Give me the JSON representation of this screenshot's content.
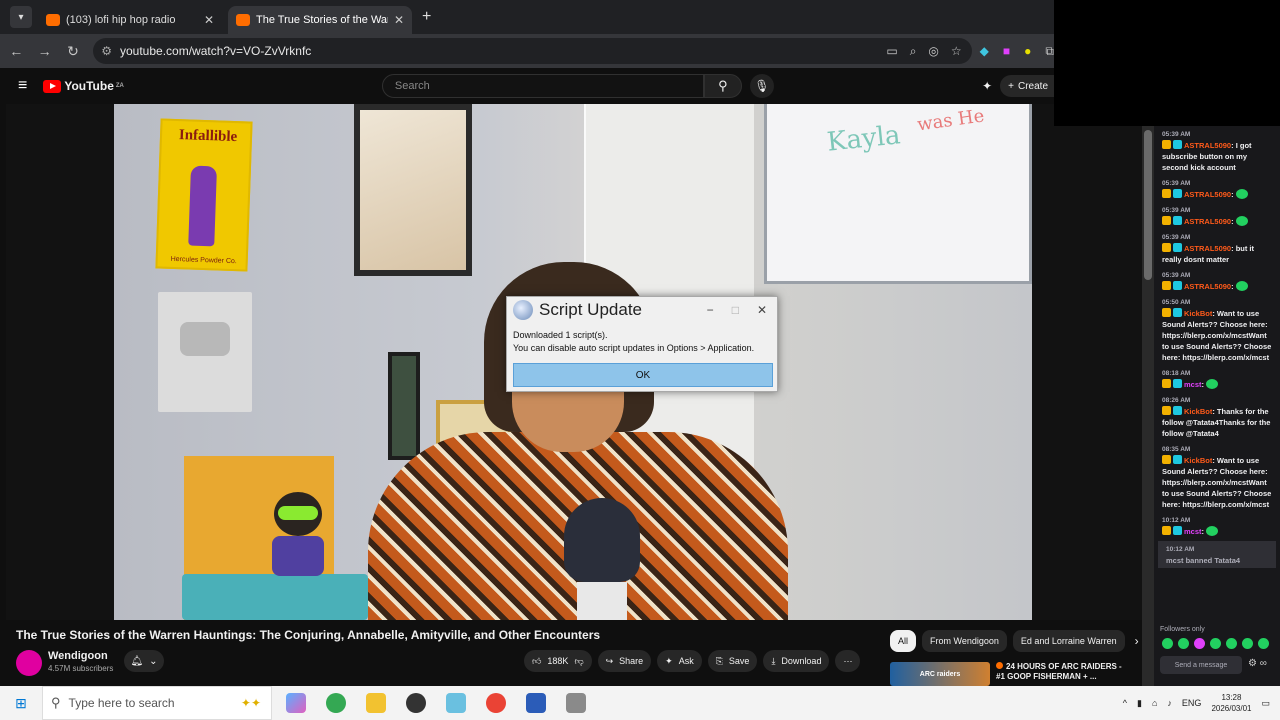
{
  "browser": {
    "tabs": [
      {
        "title": "(103) lofi hip hop radio",
        "active": false
      },
      {
        "title": "The True Stories of the War",
        "active": true
      }
    ],
    "url": "youtube.com/watch?v=VO-ZvVrknfc"
  },
  "youtube": {
    "logo_text": "YouTube",
    "logo_region": "ZA",
    "search_placeholder": "Search",
    "create_label": "Create"
  },
  "video": {
    "poster_title": "Infallible",
    "poster_footer": "Hercules Powder Co.",
    "whiteboard_text_1": "Kayla",
    "whiteboard_text_2": "was He",
    "title": "The True Stories of the Warren Hauntings: The Conjuring, Annabelle, Amityville, and Other Encounters",
    "channel": "Wendigoon",
    "subscribers": "4.57M subscribers",
    "likes": "188K",
    "share_label": "Share",
    "ask_label": "Ask",
    "save_label": "Save",
    "download_label": "Download"
  },
  "chips": [
    "All",
    "From Wendigoon",
    "Ed and Lorraine Warren"
  ],
  "up_next": {
    "thumb_text": "ARC raiders",
    "title": "24 HOURS OF ARC RAIDERS - #1 GOOP FISHERMAN + ..."
  },
  "dialog": {
    "title": "Script Update",
    "line1": "Downloaded 1 script(s).",
    "line2": "You can disable auto script updates in Options > Application.",
    "ok_label": "OK"
  },
  "chat": {
    "messages": [
      {
        "time": "05:39 AM",
        "user": "ASTRAL5090",
        "text": ": I got subscribe button on my second kick account",
        "user_color": "#ff5a1a"
      },
      {
        "time": "05:39 AM",
        "user": "ASTRAL5090",
        "text": ":",
        "user_color": "#ff5a1a",
        "emote": true
      },
      {
        "time": "05:39 AM",
        "user": "ASTRAL5090",
        "text": ":",
        "user_color": "#ff5a1a",
        "emote": true
      },
      {
        "time": "05:39 AM",
        "user": "ASTRAL5090",
        "text": ": but it really dosnt matter",
        "user_color": "#ff5a1a"
      },
      {
        "time": "05:39 AM",
        "user": "ASTRAL5090",
        "text": ":",
        "user_color": "#ff5a1a",
        "emote": true
      },
      {
        "time": "05:50 AM",
        "user": "KickBot",
        "text": ": Want to use Sound Alerts?? Choose here: https://blerp.com/x/mcstWant to use Sound Alerts?? Choose here: https://blerp.com/x/mcst",
        "user_color": "#ff5a1a"
      },
      {
        "time": "08:18 AM",
        "user": "mcst",
        "text": ":",
        "user_color": "#e040fb",
        "emote": true
      },
      {
        "time": "08:26 AM",
        "user": "KickBot",
        "text": ": Thanks for the follow @Tatata4Thanks for the follow @Tatata4",
        "user_color": "#ff5a1a"
      },
      {
        "time": "08:35 AM",
        "user": "KickBot",
        "text": ": Want to use Sound Alerts?? Choose here: https://blerp.com/x/mcstWant to use Sound Alerts?? Choose here: https://blerp.com/x/mcst",
        "user_color": "#ff5a1a"
      },
      {
        "time": "10:12 AM",
        "user": "mcst",
        "text": ":",
        "user_color": "#e040fb",
        "emote": true
      }
    ],
    "banned": {
      "time": "10:12 AM",
      "text": "mcst banned Tatata4"
    },
    "followers_only": "Followers only",
    "send_placeholder": "Send a message"
  },
  "taskbar": {
    "search_placeholder": "Type here to search",
    "language": "ENG",
    "time": "13:28",
    "date": "2026/03/01"
  }
}
